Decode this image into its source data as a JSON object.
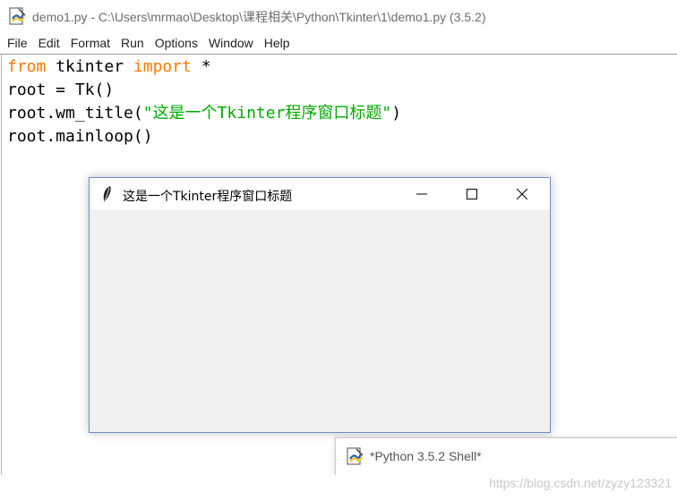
{
  "editor": {
    "title": "demo1.py - C:\\Users\\mrmao\\Desktop\\课程相关\\Python\\Tkinter\\1\\demo1.py (3.5.2)",
    "menu": [
      "File",
      "Edit",
      "Format",
      "Run",
      "Options",
      "Window",
      "Help"
    ],
    "code": {
      "line1": {
        "kw1": "from",
        "t1": " tkinter ",
        "kw2": "import",
        "t2": " *"
      },
      "line2": "root = Tk()",
      "line3": {
        "t1": "root.wm_title(",
        "str": "\"这是一个Tkinter程序窗口标题\"",
        "t2": ")"
      },
      "line4": "root.mainloop()"
    }
  },
  "tk_window": {
    "title": "这是一个Tkinter程序窗口标题"
  },
  "shell": {
    "title": "*Python 3.5.2 Shell*"
  },
  "watermark": "https://blog.csdn.net/zyzy123321",
  "colors": {
    "keyword": "#ff7700",
    "string": "#00aa00",
    "tk_border": "#6d8ec1",
    "tk_body": "#f0f0f0"
  }
}
